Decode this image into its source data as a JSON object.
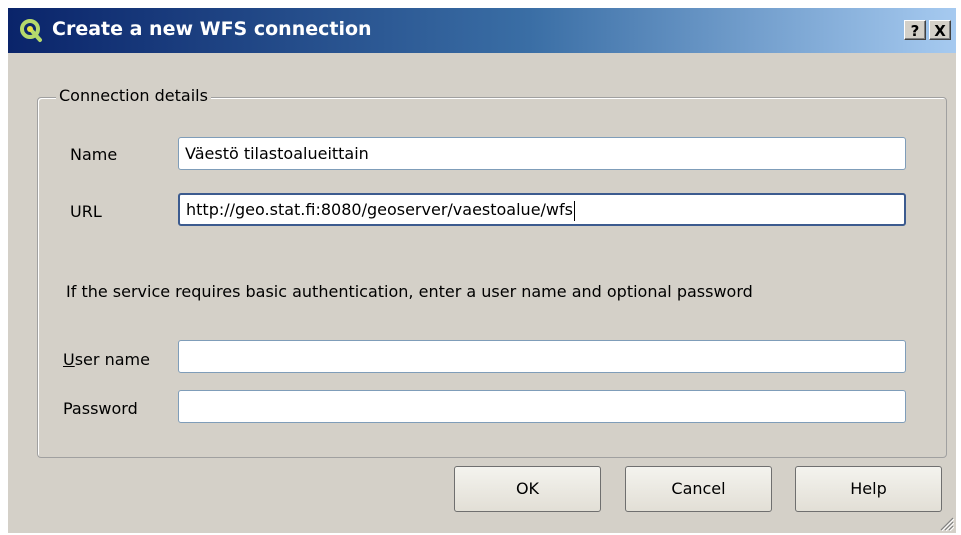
{
  "window": {
    "title": "Create a new WFS connection",
    "help_button": "?",
    "close_button": "X",
    "icon": "qgis-icon"
  },
  "connection": {
    "group_title": "Connection details",
    "name_label": "Name",
    "name_value": "Väestö tilastoalueittain",
    "url_label": "URL",
    "url_value": "http://geo.stat.fi:8080/geoserver/vaestoalue/wfs",
    "auth_info": "If the service requires basic authentication, enter a user name and optional password",
    "username_label_mnemonic": "U",
    "username_label_rest": "ser name",
    "username_value": "",
    "password_label": "Password",
    "password_value": ""
  },
  "buttons": {
    "ok": "OK",
    "cancel": "Cancel",
    "help": "Help"
  }
}
